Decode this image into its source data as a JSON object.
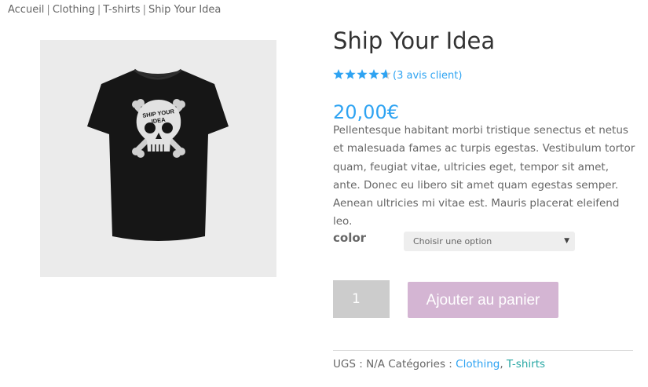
{
  "breadcrumb": {
    "items": [
      "Accueil",
      "Clothing",
      "T-shirts",
      "Ship Your Idea"
    ],
    "separator": "|"
  },
  "product": {
    "image_icon": "tshirt-skull-image",
    "image_print_text": "SHIP YOUR IDEA",
    "title": "Ship Your Idea",
    "rating": {
      "value": 4.33,
      "max": 5,
      "review_link": "(3 avis client)"
    },
    "price": "20,00€",
    "description": "Pellentesque habitant morbi tristique senectus et netus et malesuada fames ac turpis egestas. Vestibulum tortor quam, feugiat vitae, ultricies eget, tempor sit amet, ante. Donec eu libero sit amet quam egestas semper. Aenean ultricies mi vitae est. Mauris placerat eleifend leo.",
    "variation": {
      "label": "color",
      "select_value": "Choisir une option"
    },
    "quantity": "1",
    "add_to_cart": "Ajouter au panier",
    "meta": {
      "sku_label": "UGS :",
      "sku_value": "N/A",
      "categories_label": "Catégories :",
      "categories": [
        "Clothing",
        "T-shirts"
      ]
    }
  },
  "colors": {
    "accent": "#2ea3f2",
    "button": "#d4b5d3",
    "qty_bg": "#cccccc",
    "select_bg": "#eeeeee",
    "image_bg": "#ebebeb"
  }
}
